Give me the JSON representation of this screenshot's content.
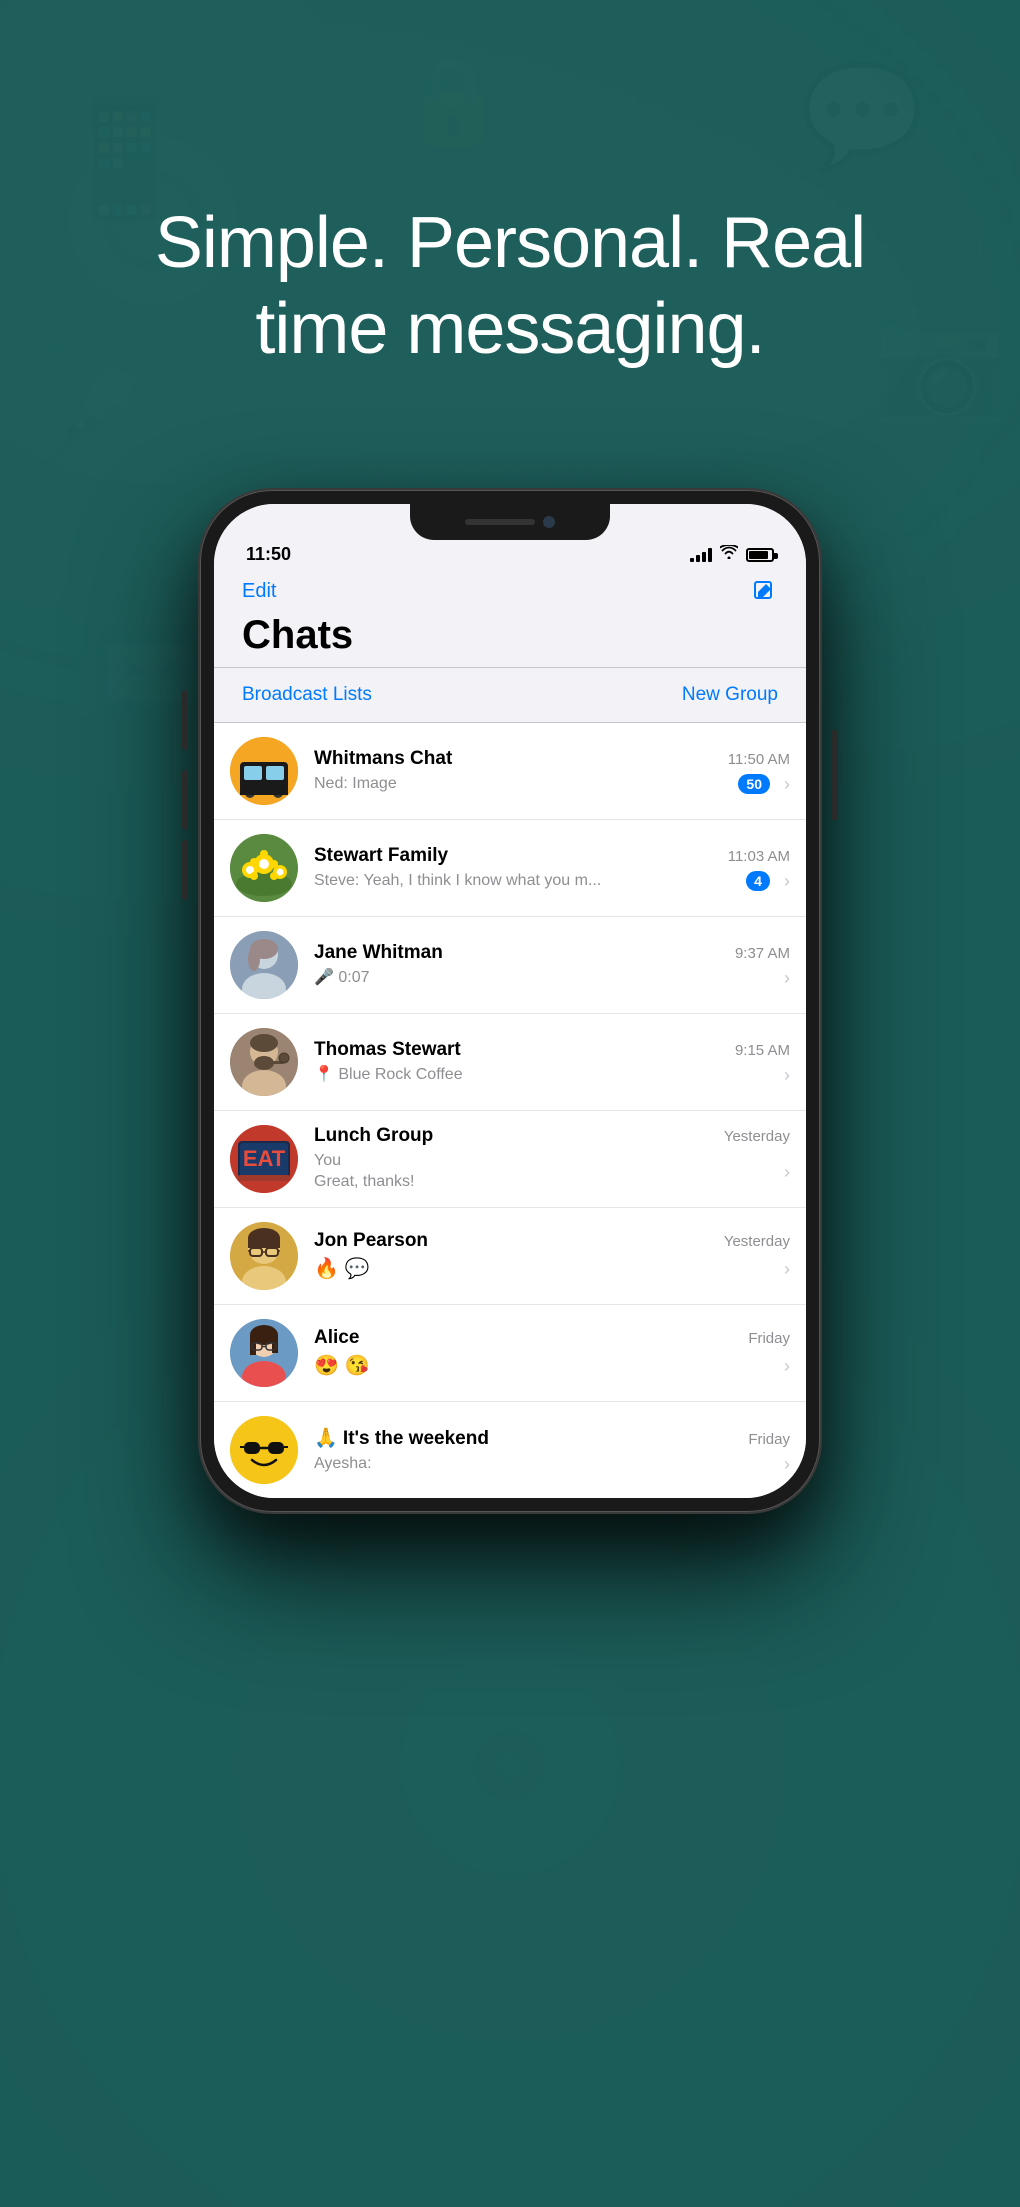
{
  "background": {
    "gradient_start": "#1a6b65",
    "gradient_end": "#0e4440"
  },
  "hero": {
    "text": "Simple. Personal. Real time messaging."
  },
  "phone": {
    "status_bar": {
      "time": "11:50",
      "signal_full": true,
      "wifi": true,
      "battery": true
    },
    "header": {
      "edit_label": "Edit",
      "title": "Chats",
      "compose_icon": "compose-icon"
    },
    "actions": {
      "broadcast_label": "Broadcast Lists",
      "new_group_label": "New Group"
    },
    "chats": [
      {
        "id": "whitmans-chat",
        "name": "Whitmans Chat",
        "time": "11:50 AM",
        "sender": "Ned:",
        "preview": "Image",
        "badge": "50",
        "avatar_type": "bus",
        "avatar_emoji": "🚌"
      },
      {
        "id": "stewart-family",
        "name": "Stewart Family",
        "time": "11:03 AM",
        "sender": "Steve:",
        "preview": "Yeah, I think I know what you m...",
        "badge": "4",
        "avatar_type": "flowers",
        "avatar_emoji": "🌼"
      },
      {
        "id": "jane-whitman",
        "name": "Jane Whitman",
        "time": "9:37 AM",
        "sender": "",
        "preview": "🎤 0:07",
        "badge": "",
        "avatar_type": "person-gray",
        "avatar_emoji": "👩"
      },
      {
        "id": "thomas-stewart",
        "name": "Thomas Stewart",
        "time": "9:15 AM",
        "sender": "",
        "preview": "📍 Blue Rock Coffee",
        "badge": "",
        "avatar_type": "person-brown",
        "avatar_emoji": "👨"
      },
      {
        "id": "lunch-group",
        "name": "Lunch Group",
        "time": "Yesterday",
        "sender": "You",
        "preview": "Great, thanks!",
        "badge": "",
        "avatar_type": "eat-sign",
        "avatar_emoji": "🍽️"
      },
      {
        "id": "jon-pearson",
        "name": "Jon Pearson",
        "time": "Yesterday",
        "sender": "",
        "preview": "🔥 💬",
        "badge": "",
        "avatar_type": "person-glasses",
        "avatar_emoji": "👓"
      },
      {
        "id": "alice",
        "name": "Alice",
        "time": "Friday",
        "sender": "",
        "preview": "😍 😘",
        "badge": "",
        "avatar_type": "person-alice",
        "avatar_emoji": "👩"
      },
      {
        "id": "weekend",
        "name": "🙏 It's the weekend",
        "time": "Friday",
        "sender": "Ayesha:",
        "preview": "",
        "badge": "",
        "avatar_type": "sunglasses",
        "avatar_emoji": "😎"
      }
    ]
  }
}
